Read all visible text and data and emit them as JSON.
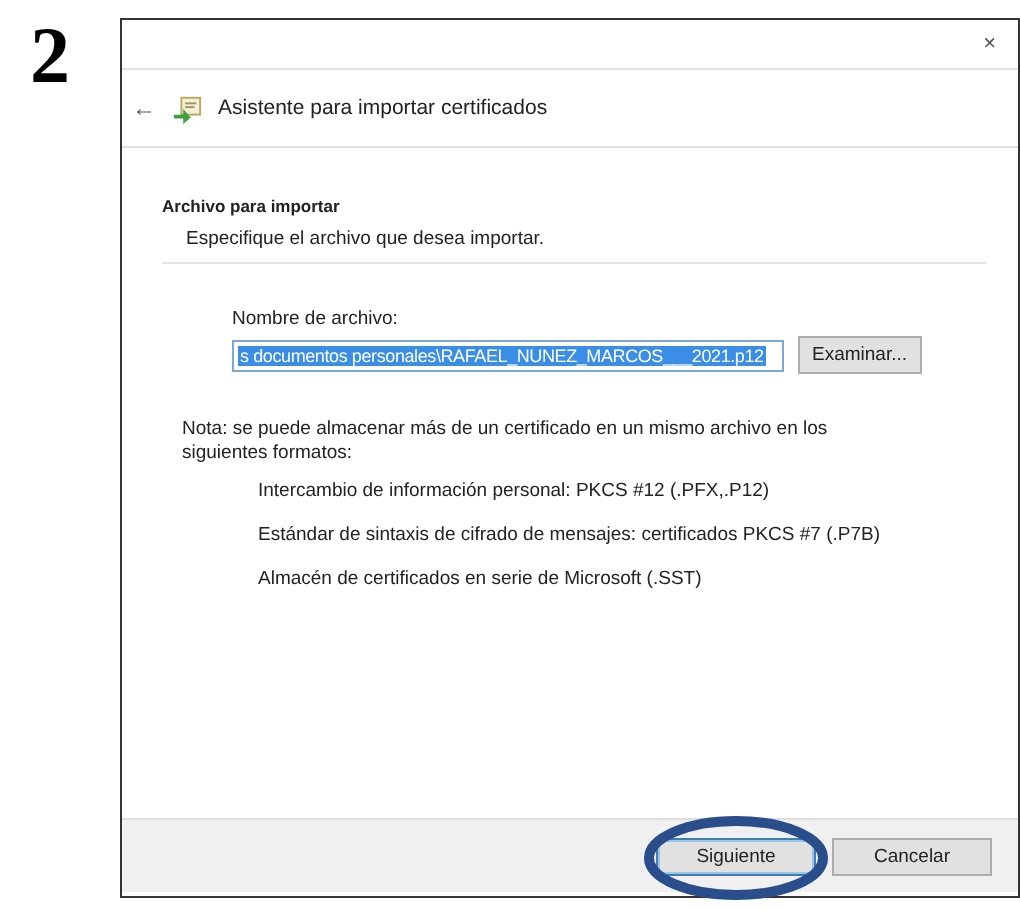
{
  "step_number": "2",
  "window": {
    "close": "×",
    "back": "←",
    "title": "Asistente para importar certificados"
  },
  "section": {
    "heading": "Archivo para importar",
    "subheading": "Especifique el archivo que desea importar."
  },
  "file_field": {
    "label": "Nombre de archivo:",
    "value": "s documentos personales\\RAFAEL_NUNEZ_MARCOS___2021.p12",
    "selected": true,
    "browse_button": "Examinar..."
  },
  "note": "Nota: se puede almacenar más de un certificado en un mismo archivo en los siguientes formatos:",
  "formats": [
    "Intercambio de información personal: PKCS #12 (.PFX,.P12)",
    "Estándar de sintaxis de cifrado de mensajes: certificados PKCS #7 (.P7B)",
    "Almacén de certificados en serie de Microsoft (.SST)"
  ],
  "buttons": [
    {
      "label": "Siguiente",
      "default": true,
      "highlighted": true
    },
    {
      "label": "Cancelar",
      "default": false,
      "highlighted": false
    }
  ]
}
